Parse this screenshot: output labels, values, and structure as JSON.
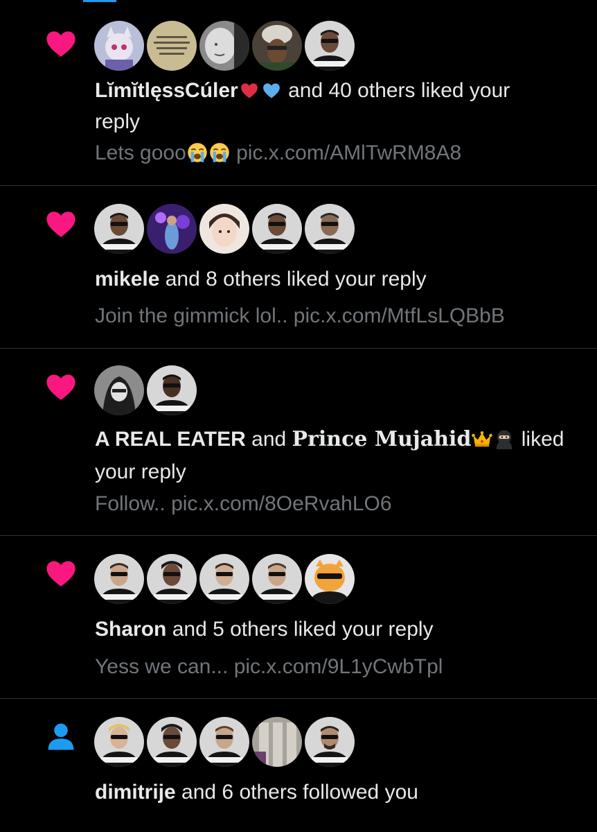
{
  "notifications": [
    {
      "type": "like",
      "icon": "heart-icon",
      "actor": "LĭmĭtlęssCúler",
      "actor_emojis": [
        "red-heart",
        "blue-heart"
      ],
      "text1": "and 40 others liked your",
      "text2": "reply",
      "preview_text": "Lets gooo",
      "preview_emojis": [
        "loudly-crying-face",
        "loudly-crying-face"
      ],
      "preview_link": "pic.x.com/AMlTwRM8A8",
      "avatars": [
        "anime-cat",
        "note-card",
        "baby-bw",
        "helmet-person",
        "sunglasses-man"
      ]
    },
    {
      "type": "like",
      "icon": "heart-icon",
      "actor": "mikele",
      "text1": "and 8 others liked your reply",
      "preview_text": "Join the gimmick lol..",
      "preview_link": "pic.x.com/MtfLsLQBbB",
      "avatars": [
        "sunglasses-man",
        "concert-purple",
        "girl-photo",
        "sunglasses-man",
        "sunglasses-man"
      ]
    },
    {
      "type": "like",
      "icon": "heart-icon",
      "actor": "A REAL EATER",
      "joiner": "and",
      "actor2": "Prince Mujahid",
      "actor2_emojis": [
        "crown",
        "ninja"
      ],
      "text1": "liked",
      "text2": "your reply",
      "preview_text": "Follow..",
      "preview_link": "pic.x.com/8OeRvahLO6",
      "avatars": [
        "hooded-figure",
        "sunglasses-man"
      ]
    },
    {
      "type": "like",
      "icon": "heart-icon",
      "actor": "Sharon",
      "text1": "and 5 others liked your reply",
      "preview_text": "Yess we can...",
      "preview_link": "pic.x.com/9L1yCwbTpl",
      "avatars": [
        "sunglasses-man",
        "sunglasses-man",
        "sunglasses-man",
        "sunglasses-man",
        "cartoon-tiger"
      ]
    },
    {
      "type": "follow",
      "icon": "person-icon",
      "actor": "dimitrije",
      "text1": "and 6 others followed you",
      "avatars": [
        "sunglasses-man-blond",
        "sunglasses-man",
        "sunglasses-man",
        "building-photo",
        "sunglasses-man"
      ]
    }
  ],
  "colors": {
    "heart": "#f91880",
    "follow": "#1d9bf0",
    "muted": "#71767b",
    "text": "#e7e9ea",
    "divider": "#2f3336"
  }
}
